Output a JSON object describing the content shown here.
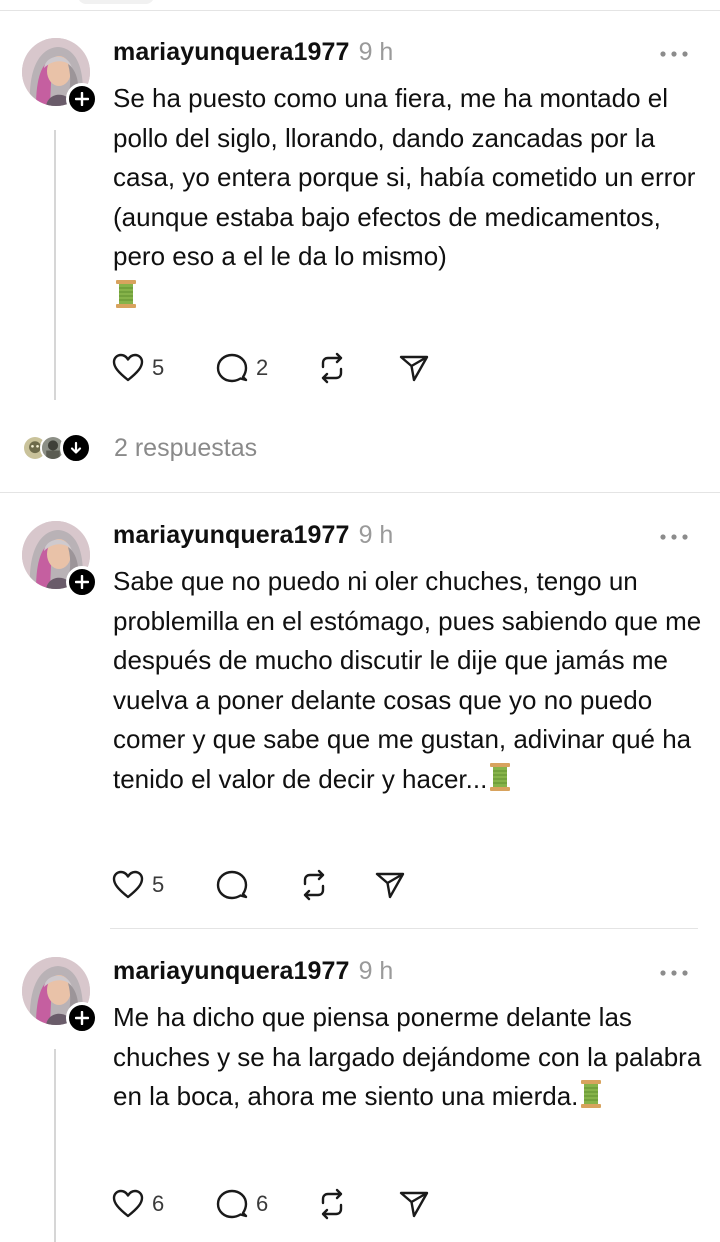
{
  "colors": {
    "text": "#101010",
    "muted": "#9a9a9a",
    "divider": "#e4e4e4",
    "thread_line": "#d6d6d6",
    "badge": "#000000"
  },
  "icons": {
    "more": "more-dots-icon",
    "like": "heart-icon",
    "reply": "comment-bubble-icon",
    "repost": "repost-icon",
    "share": "send-icon",
    "follow": "plus-icon",
    "expand": "arrow-down-icon",
    "emoji": "thread-spool-emoji"
  },
  "posts": [
    {
      "username": "mariayunquera1977",
      "time": "9 h",
      "text": "Se ha puesto como una fiera, me ha montado el pollo del siglo, llorando, dando zancadas por la casa, yo entera porque si, había cometido un error (aunque estaba bajo efectos de medicamentos, pero eso a el le da lo mismo)",
      "emoji": "🧵",
      "likes": "5",
      "replies": "2"
    },
    {
      "username": "mariayunquera1977",
      "time": "9 h",
      "text": "Sabe que no puedo ni oler chuches, tengo un problemilla en el estómago, pues sabiendo que me después de mucho discutir le dije que jamás me vuelva a poner delante cosas que yo no puedo comer y que sabe que me gustan, adivinar qué ha tenido el valor de decir y hacer...",
      "emoji": "🧵",
      "likes": "5",
      "replies": ""
    },
    {
      "username": "mariayunquera1977",
      "time": "9 h",
      "text": "Me ha dicho que piensa ponerme delante las chuches y se ha largado dejándome con la palabra en la boca, ahora me siento una mierda.",
      "emoji": "🧵",
      "likes": "6",
      "replies": "6"
    }
  ],
  "replies_summary": {
    "label": "2 respuestas"
  }
}
